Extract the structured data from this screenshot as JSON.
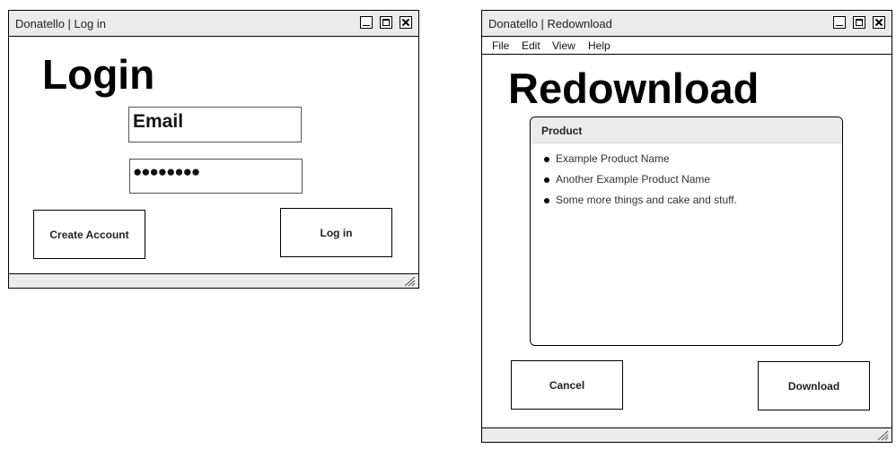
{
  "login_window": {
    "title": "Donatello | Log in",
    "heading": "Login",
    "email_value": "Email",
    "password_value": "●●●●●●●●",
    "create_account_label": "Create Account",
    "login_label": "Log in"
  },
  "redownload_window": {
    "title": "Donatello | Redownload",
    "menu": [
      "File",
      "Edit",
      "View",
      "Help"
    ],
    "heading": "Redownload",
    "panel_header": "Product",
    "products": [
      "Example Product Name",
      "Another Example Product Name",
      "Some more things and cake and stuff."
    ],
    "cancel_label": "Cancel",
    "download_label": "Download"
  }
}
